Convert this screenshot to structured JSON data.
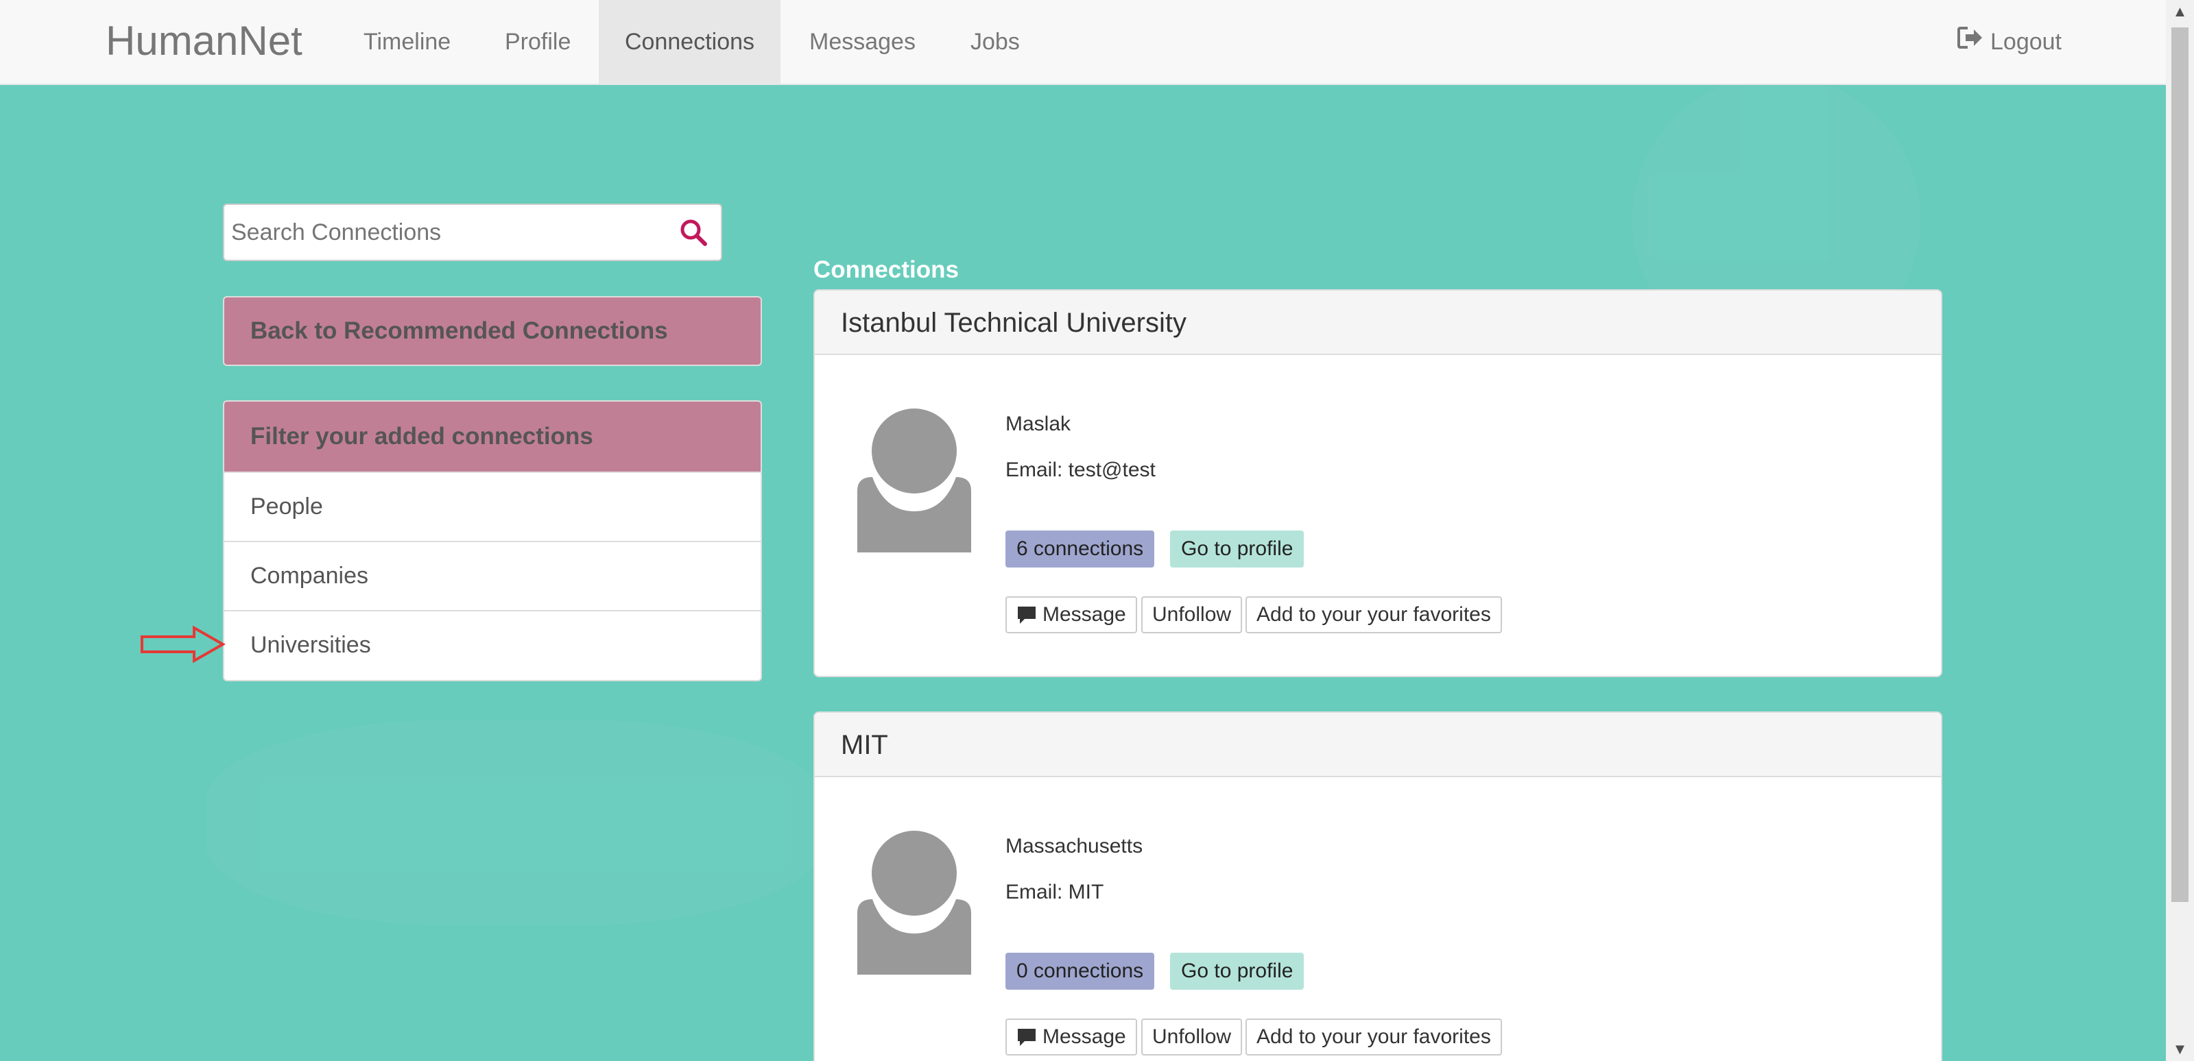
{
  "nav": {
    "brand": "HumanNet",
    "items": [
      "Timeline",
      "Profile",
      "Connections",
      "Messages",
      "Jobs"
    ],
    "active": "Connections",
    "logout": "Logout"
  },
  "search": {
    "placeholder": "Search Connections"
  },
  "back_button": "Back to Recommended Connections",
  "filter": {
    "title": "Filter your added connections",
    "items": [
      "People",
      "Companies",
      "Universities"
    ]
  },
  "section_title": "Connections",
  "cards": [
    {
      "name": "Istanbul Technical University",
      "location": "Maslak",
      "email": "Email: test@test",
      "connections": "6 connections",
      "goto": "Go to profile",
      "actions": [
        "Message",
        "Unfollow",
        "Add to your your favorites"
      ]
    },
    {
      "name": "MIT",
      "location": "Massachusetts",
      "email": "Email: MIT",
      "connections": "0 connections",
      "goto": "Go to profile",
      "actions": [
        "Message",
        "Unfollow",
        "Add to your your favorites"
      ]
    }
  ],
  "colors": {
    "background": "#67ccbc",
    "panel_header": "#c17f96",
    "badge_connections": "#9ea6cf",
    "badge_profile": "#b4e4d9",
    "search_icon": "#c2185b",
    "annotation_arrow": "#e53935"
  }
}
